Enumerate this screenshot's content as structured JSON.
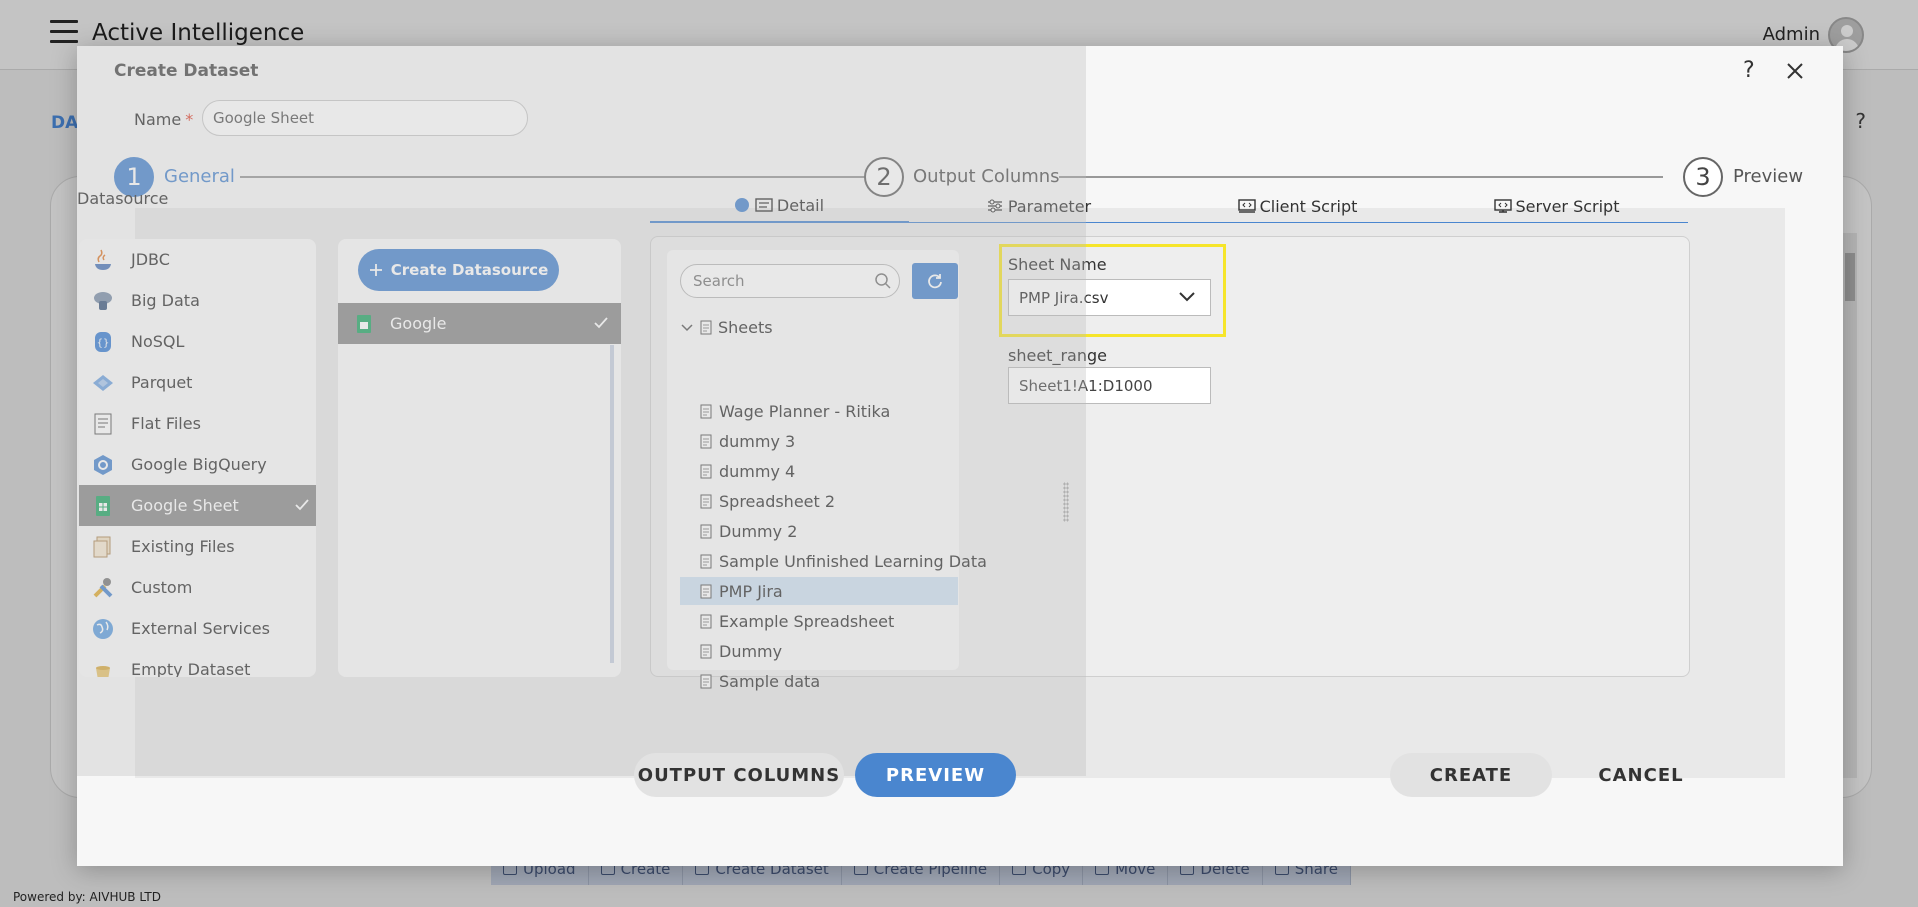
{
  "app": {
    "title": "Active Intelligence",
    "user": "Admin",
    "powered_by": "Powered by: AIVHUB LTD",
    "bg_breadcrumb": "DA",
    "bg_help": "?",
    "bg_toolbar": [
      "Upload",
      "Create",
      "Create Dataset",
      "Create Pipeline",
      "Copy",
      "Move",
      "Delete",
      "Share"
    ]
  },
  "modal": {
    "title": "Create Dataset",
    "help": "?",
    "name_label": "Name",
    "name_required": "*",
    "name_value": "Google Sheet",
    "steps": [
      {
        "num": "1",
        "label": "General",
        "active": true
      },
      {
        "num": "2",
        "label": "Output Columns",
        "active": false
      },
      {
        "num": "3",
        "label": "Preview",
        "active": false
      }
    ],
    "datasource_title": "Datasource",
    "datasources": [
      {
        "label": "JDBC",
        "icon": "jdbc-icon"
      },
      {
        "label": "Big Data",
        "icon": "big-data-icon"
      },
      {
        "label": "NoSQL",
        "icon": "nosql-icon"
      },
      {
        "label": "Parquet",
        "icon": "parquet-icon"
      },
      {
        "label": "Flat Files",
        "icon": "flat-files-icon"
      },
      {
        "label": "Google BigQuery",
        "icon": "bigquery-icon"
      },
      {
        "label": "Google Sheet",
        "icon": "google-sheet-icon",
        "selected": true
      },
      {
        "label": "Existing Files",
        "icon": "existing-files-icon"
      },
      {
        "label": "Custom",
        "icon": "custom-tools-icon"
      },
      {
        "label": "External Services",
        "icon": "globe-icon"
      },
      {
        "label": "Empty Dataset",
        "icon": "empty-dataset-icon"
      }
    ],
    "create_datasource_label": "Create Datasource",
    "connection": "Google",
    "tabs": [
      "Detail",
      "Parameter",
      "Client Script",
      "Server Script"
    ],
    "search_placeholder": "Search",
    "tree_root": "Sheets",
    "sheets": [
      {
        "label": "Wage Planner - Ritika"
      },
      {
        "label": "dummy 3"
      },
      {
        "label": "dummy 4"
      },
      {
        "label": "Spreadsheet 2"
      },
      {
        "label": "Dummy 2"
      },
      {
        "label": "Sample Unfinished Learning Data"
      },
      {
        "label": "PMP Jira",
        "selected": true
      },
      {
        "label": "Example Spreadsheet"
      },
      {
        "label": "Dummy"
      },
      {
        "label": "Sample data"
      }
    ],
    "sheet_name_label": "Sheet Name",
    "sheet_name_value": "PMP Jira.csv",
    "sheet_range_label": "sheet_range",
    "sheet_range_value": "Sheet1!A1:D1000",
    "buttons": {
      "output_columns": "OUTPUT COLUMNS",
      "preview": "PREVIEW",
      "create": "CREATE",
      "cancel": "CANCEL"
    }
  },
  "colors": {
    "accent": "#4a86cf",
    "highlight": "#f6e52a",
    "selected_row": "#8a8a8a",
    "tree_selected": "#cfe2f3"
  }
}
